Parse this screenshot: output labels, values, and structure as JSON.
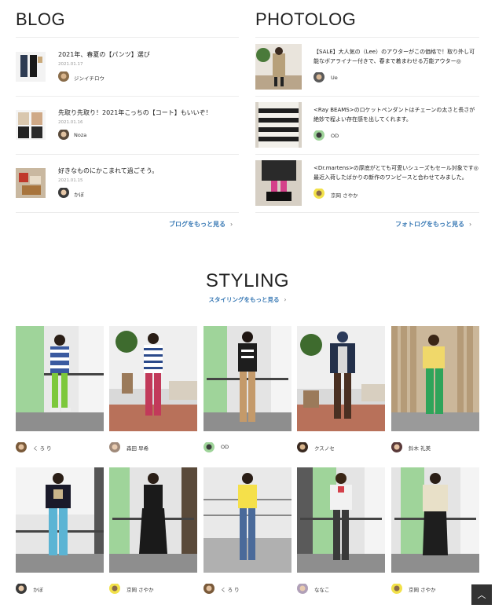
{
  "blog": {
    "title": "BLOG",
    "items": [
      {
        "text": "2021年、春夏の【パンツ】選び",
        "date": "2021.01.17",
        "author": "ジンイチロウ"
      },
      {
        "text": "先取り先取り！2021年こっちの【コート】もいいぞ！",
        "date": "2021.01.16",
        "author": "Noza"
      },
      {
        "text": "好きなものにかこまれて過ごそう。",
        "date": "2021.01.15",
        "author": "かぼ"
      }
    ],
    "more_label": "ブログをもっと見る",
    "more_chevron": "›"
  },
  "photolog": {
    "title": "PHOTOLOG",
    "items": [
      {
        "text": "【SALE】大人気の（Lee）のアウターがこの価格で！取り外し可能なボアライナー付きで、春まで着まわせる万能アウター◎",
        "author": "Ue"
      },
      {
        "text": "<Ray BEAMS>のロケットペンダントはチェーンの太さと長さが絶妙で程よい存在感を出してくれます。",
        "author": "OD"
      },
      {
        "text": "<Dr.martens>の厚底がとても可愛いシューズもセール対象です◎最近入荷したばかりの新作のワンピースと合わせてみました。",
        "author": "京岡 さやか"
      }
    ],
    "more_label": "フォトログをもっと見る",
    "more_chevron": "›"
  },
  "styling": {
    "title": "STYLING",
    "more_label": "スタイリングをもっと見る",
    "more_chevron": "›",
    "cards": [
      {
        "name": "く ろ り"
      },
      {
        "name": "森田 早希"
      },
      {
        "name": "OD"
      },
      {
        "name": "クスノセ"
      },
      {
        "name": "鈴木 礼美"
      },
      {
        "name": "かぼ"
      },
      {
        "name": "京岡 さやか"
      },
      {
        "name": "く ろ り"
      },
      {
        "name": "ななこ"
      },
      {
        "name": "京岡 さやか"
      }
    ]
  },
  "back_to_top": {
    "icon": "chevron-up-icon",
    "glyph": "︿"
  },
  "colors": {
    "link": "#3a7ab5",
    "accent_green": "#9fd49a"
  }
}
